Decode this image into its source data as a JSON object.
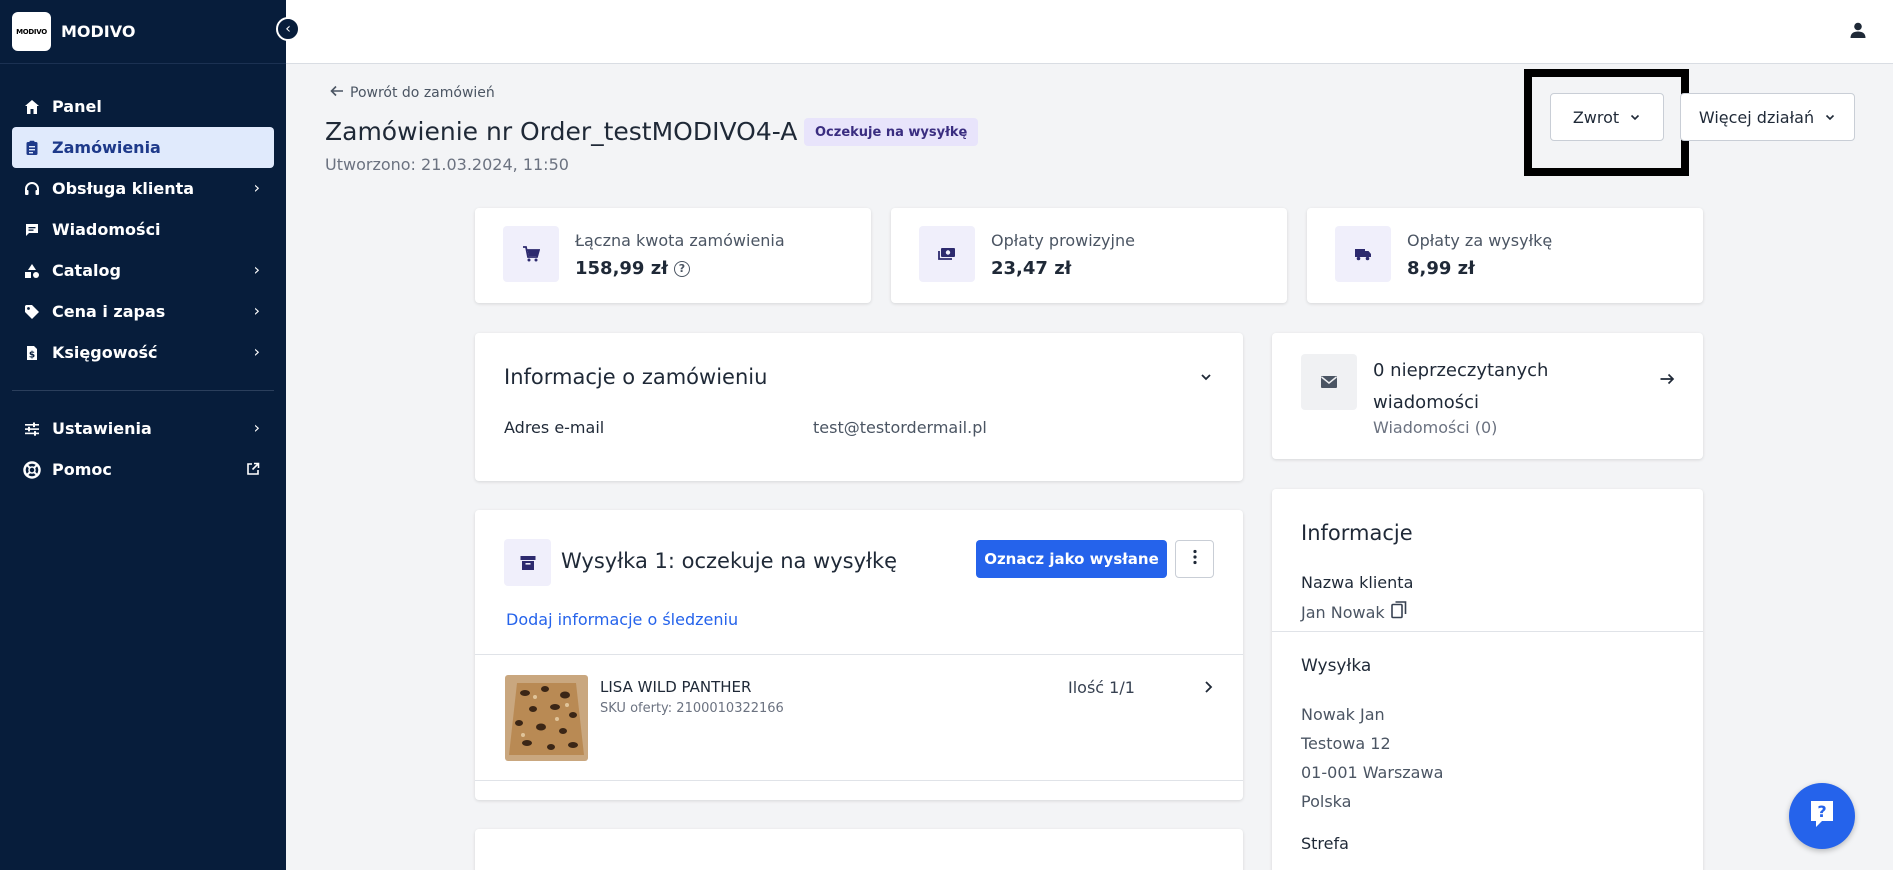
{
  "brand": {
    "logo_text": "MODIVO",
    "name": "MODIVO"
  },
  "sidebar": {
    "collapse_glyph": "‹",
    "items": [
      {
        "label": "Panel",
        "icon": "home-icon",
        "has_chevron": false,
        "active": false
      },
      {
        "label": "Zamówienia",
        "icon": "clipboard-icon",
        "has_chevron": false,
        "active": true
      },
      {
        "label": "Obsługa klienta",
        "icon": "headset-icon",
        "has_chevron": true,
        "active": false
      },
      {
        "label": "Wiadomości",
        "icon": "chat-icon",
        "has_chevron": false,
        "active": false
      },
      {
        "label": "Catalog",
        "icon": "shapes-icon",
        "has_chevron": true,
        "active": false
      },
      {
        "label": "Cena i zapas",
        "icon": "tag-icon",
        "has_chevron": true,
        "active": false
      },
      {
        "label": "Księgowość",
        "icon": "dollar-doc-icon",
        "has_chevron": true,
        "active": false
      }
    ],
    "bottom_items": [
      {
        "label": "Ustawienia",
        "icon": "sliders-icon",
        "has_chevron": true
      },
      {
        "label": "Pomoc",
        "icon": "lifebuoy-icon",
        "external": true
      }
    ],
    "chevron_glyph": "›"
  },
  "header": {
    "back_label": "Powrót do zamówień",
    "title": "Zamówienie nr Order_testMODIVO4-A",
    "status": "Oczekuje na wysyłkę",
    "created": "Utworzono: 21.03.2024, 11:50",
    "return_button": "Zwrot",
    "more_actions_button": "Więcej działań"
  },
  "stats": [
    {
      "label": "Łączna kwota zamówienia",
      "value": "158,99 zł",
      "icon": "cart-icon",
      "help": "?"
    },
    {
      "label": "Opłaty prowizyjne",
      "value": "23,47 zł",
      "icon": "money-icon"
    },
    {
      "label": "Opłaty za wysyłkę",
      "value": "8,99 zł",
      "icon": "truck-icon"
    }
  ],
  "order_info": {
    "title": "Informacje o zamówieniu",
    "email_label": "Adres e-mail",
    "email_value": "test@testordermail.pl"
  },
  "shipment": {
    "title": "Wysyłka 1: oczekuje na wysyłkę",
    "mark_sent_button": "Oznacz jako wysłane",
    "tracking_link": "Dodaj informacje o śledzeniu",
    "product": {
      "name": "LISA WILD PANTHER",
      "sku": "SKU oferty: 2100010322166",
      "quantity": "Ilość 1/1"
    }
  },
  "messages": {
    "title_line1": "0 nieprzeczytanych",
    "title_line2": "wiadomości",
    "subtitle": "Wiadomości (0)"
  },
  "info_panel": {
    "title": "Informacje",
    "customer_label": "Nazwa klienta",
    "customer_value": "Jan Nowak",
    "shipping_title": "Wysyłka",
    "address": [
      "Nowak Jan",
      "Testowa 12",
      "01-001 Warszawa",
      "Polska"
    ],
    "zone_title": "Strefa"
  },
  "colors": {
    "sidebar_bg": "#071d3b",
    "primary": "#2563eb",
    "badge_bg": "#e8e4fb",
    "badge_text": "#3a2d80"
  }
}
